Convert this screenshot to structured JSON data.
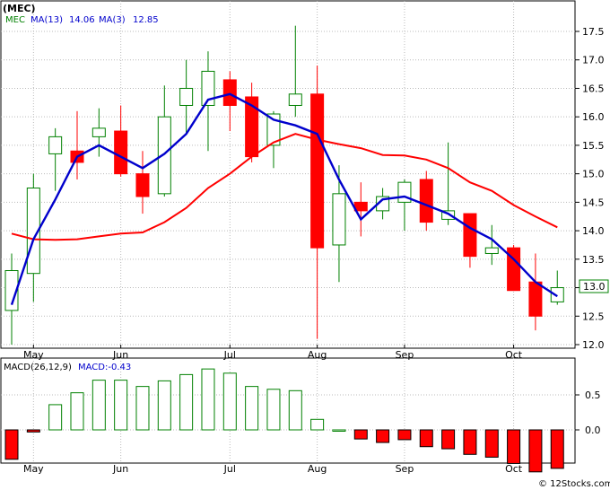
{
  "title": "(MEC)",
  "legend_top": {
    "ticker": "MEC",
    "ma13_label": "MA(13)",
    "ma13_value": "14.06",
    "ma3_label": "MA(3)",
    "ma3_value": "12.85"
  },
  "legend_bottom": {
    "macd_label": "MACD(26,12,9)",
    "macd_value_label": "MACD:-0.43"
  },
  "current_price_label": "13.0",
  "watermark": "© 12Stocks.com",
  "colors": {
    "up": "#008000",
    "down": "#ff0000",
    "ma13": "#ff0000",
    "ma3": "#0000cc",
    "grid": "#bbbbbb",
    "axis": "#000000"
  },
  "chart_data": {
    "type": "candlestick",
    "x_labels": [
      "May",
      "Jun",
      "Jul",
      "Aug",
      "Sep",
      "Oct"
    ],
    "month_start_index": [
      1,
      5,
      10,
      14,
      18,
      23
    ],
    "y_ticks": [
      12.0,
      12.5,
      13.0,
      13.5,
      14.0,
      14.5,
      15.0,
      15.5,
      16.0,
      16.5,
      17.0,
      17.5
    ],
    "ylim": [
      11.97,
      17.75
    ],
    "candles": [
      {
        "o": 12.6,
        "h": 13.6,
        "l": 12.0,
        "c": 13.3
      },
      {
        "o": 13.25,
        "h": 15.0,
        "l": 12.75,
        "c": 14.75
      },
      {
        "o": 15.35,
        "h": 15.8,
        "l": 14.7,
        "c": 15.65
      },
      {
        "o": 15.4,
        "h": 16.1,
        "l": 14.9,
        "c": 15.2
      },
      {
        "o": 15.65,
        "h": 16.15,
        "l": 15.3,
        "c": 15.8
      },
      {
        "o": 15.75,
        "h": 16.2,
        "l": 14.95,
        "c": 15.0
      },
      {
        "o": 15.0,
        "h": 15.4,
        "l": 14.3,
        "c": 14.6
      },
      {
        "o": 14.65,
        "h": 16.55,
        "l": 14.6,
        "c": 16.0
      },
      {
        "o": 16.2,
        "h": 17.0,
        "l": 15.7,
        "c": 16.5
      },
      {
        "o": 16.2,
        "h": 17.15,
        "l": 15.4,
        "c": 16.8
      },
      {
        "o": 16.65,
        "h": 16.8,
        "l": 15.75,
        "c": 16.2
      },
      {
        "o": 16.35,
        "h": 16.6,
        "l": 15.2,
        "c": 15.3
      },
      {
        "o": 15.5,
        "h": 16.1,
        "l": 15.1,
        "c": 16.05
      },
      {
        "o": 16.2,
        "h": 17.6,
        "l": 16.0,
        "c": 16.4
      },
      {
        "o": 16.4,
        "h": 16.9,
        "l": 12.1,
        "c": 13.7
      },
      {
        "o": 13.75,
        "h": 15.15,
        "l": 13.1,
        "c": 14.65
      },
      {
        "o": 14.5,
        "h": 14.85,
        "l": 13.9,
        "c": 14.35
      },
      {
        "o": 14.35,
        "h": 14.75,
        "l": 14.2,
        "c": 14.6
      },
      {
        "o": 14.5,
        "h": 14.9,
        "l": 14.0,
        "c": 14.85
      },
      {
        "o": 14.9,
        "h": 15.05,
        "l": 14.0,
        "c": 14.15
      },
      {
        "o": 14.2,
        "h": 15.55,
        "l": 14.1,
        "c": 14.35
      },
      {
        "o": 14.3,
        "h": 14.3,
        "l": 13.35,
        "c": 13.55
      },
      {
        "o": 13.6,
        "h": 14.1,
        "l": 13.4,
        "c": 13.7
      },
      {
        "o": 13.7,
        "h": 13.75,
        "l": 12.95,
        "c": 12.95
      },
      {
        "o": 13.1,
        "h": 13.6,
        "l": 12.25,
        "c": 12.5
      },
      {
        "o": 12.75,
        "h": 13.3,
        "l": 12.7,
        "c": 13.0
      }
    ],
    "ma13": [
      13.95,
      13.85,
      null,
      null,
      null,
      null,
      null,
      null,
      null,
      null,
      null,
      null,
      null,
      15.7,
      15.6,
      15.5,
      15.45,
      15.35,
      15.3,
      15.1,
      14.75,
      14.55,
      14.4,
      14.15,
      13.95,
      14.06
    ],
    "ma13_x": [
      0,
      1.3,
      null,
      null,
      null,
      null,
      null,
      null,
      null,
      null,
      null,
      null,
      null,
      13.0,
      14.0,
      15.0,
      16.0,
      17.0,
      18.0,
      19.0,
      20.0,
      21.0,
      22.0,
      23.0,
      24.0,
      25.3
    ],
    "ma3": [
      12.7,
      13.85,
      14.5,
      15.3,
      15.4,
      15.3,
      15.3,
      15.25,
      15.75,
      16.35,
      16.4,
      16.1,
      16.0,
      15.85,
      15.7,
      15.4,
      14.5,
      14.55,
      14.55,
      14.45,
      14.25,
      14.15,
      13.85,
      13.5,
      13.2,
      12.85
    ],
    "ma13_points": [
      [
        0,
        13.95
      ],
      [
        1,
        13.85
      ],
      [
        2,
        13.84
      ],
      [
        3,
        13.85
      ],
      [
        4,
        13.9
      ],
      [
        5,
        13.95
      ],
      [
        6,
        13.97
      ],
      [
        7,
        14.15
      ],
      [
        8,
        14.4
      ],
      [
        9,
        14.75
      ],
      [
        10,
        15.0
      ],
      [
        11,
        15.3
      ],
      [
        12,
        15.55
      ],
      [
        13,
        15.7
      ],
      [
        14,
        15.6
      ],
      [
        15,
        15.52
      ],
      [
        16,
        15.45
      ],
      [
        17,
        15.33
      ],
      [
        18,
        15.32
      ],
      [
        19,
        15.25
      ],
      [
        20,
        15.1
      ],
      [
        21,
        14.85
      ],
      [
        22,
        14.7
      ],
      [
        23,
        14.45
      ],
      [
        24,
        14.25
      ],
      [
        25,
        14.06
      ]
    ],
    "ma3_points": [
      [
        0,
        12.7
      ],
      [
        1,
        13.85
      ],
      [
        2,
        14.55
      ],
      [
        3,
        15.3
      ],
      [
        4,
        15.5
      ],
      [
        5,
        15.3
      ],
      [
        6,
        15.1
      ],
      [
        7,
        15.35
      ],
      [
        8,
        15.7
      ],
      [
        9,
        16.3
      ],
      [
        10,
        16.4
      ],
      [
        11,
        16.2
      ],
      [
        12,
        15.95
      ],
      [
        13,
        15.85
      ],
      [
        14,
        15.7
      ],
      [
        15,
        14.9
      ],
      [
        16,
        14.2
      ],
      [
        17,
        14.55
      ],
      [
        18,
        14.6
      ],
      [
        19,
        14.45
      ],
      [
        20,
        14.3
      ],
      [
        21,
        14.05
      ],
      [
        22,
        13.85
      ],
      [
        23,
        13.5
      ],
      [
        24,
        13.1
      ],
      [
        25,
        12.85
      ]
    ],
    "macd_ticks": [
      0.5,
      0.0
    ],
    "macd_ylim": [
      -0.6,
      0.9
    ],
    "macd": [
      -0.42,
      -0.03,
      0.36,
      0.53,
      0.71,
      0.71,
      0.62,
      0.7,
      0.79,
      0.87,
      0.81,
      0.62,
      0.58,
      0.56,
      0.15,
      0.0,
      -0.13,
      -0.18,
      -0.14,
      -0.24,
      -0.27,
      -0.35,
      -0.39,
      -0.48,
      -0.6,
      -0.55
    ]
  }
}
